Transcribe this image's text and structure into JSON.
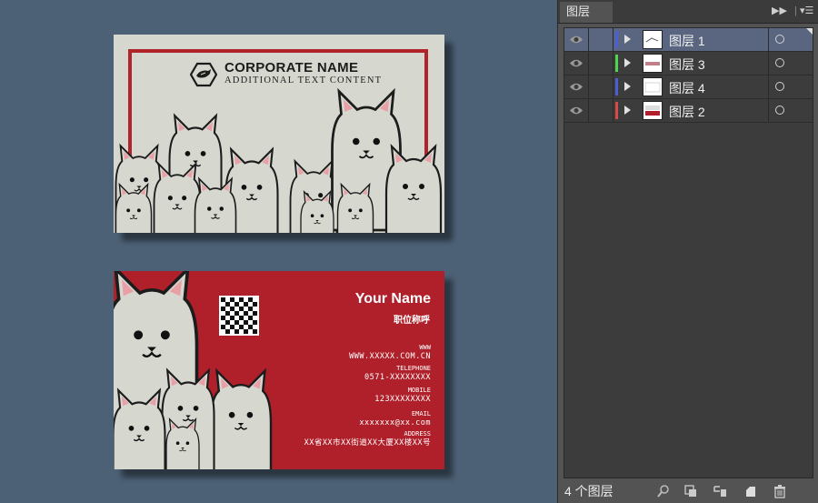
{
  "front_card": {
    "corp_name": "CORPORATE NAME",
    "corp_sub": "ADDITIONAL TEXT CONTENT"
  },
  "back_card": {
    "your_name": "Your Name",
    "job_title": "职位称呼",
    "contacts": [
      {
        "label": "WWW",
        "value": "WWW.XXXXX.COM.CN"
      },
      {
        "label": "TELEPHONE",
        "value": "0571-XXXXXXXX"
      },
      {
        "label": "MOBILE",
        "value": "123XXXXXXXX"
      },
      {
        "label": "EMAIL",
        "value": "xxxxxxx@xx.com"
      },
      {
        "label": "ADDRESS",
        "value": "XX省XX市XX街道XX大厦XX楼XX号"
      }
    ]
  },
  "layers_panel": {
    "title": "图层",
    "layers": [
      {
        "name": "图层 1",
        "color": "#4a5fd6",
        "selected": true
      },
      {
        "name": "图层 3",
        "color": "#4fd64f",
        "selected": false
      },
      {
        "name": "图层 4",
        "color": "#4a5fd6",
        "selected": false
      },
      {
        "name": "图层 2",
        "color": "#d64a4a",
        "selected": false
      }
    ],
    "count_text": "4 个图层"
  },
  "colors": {
    "card_red": "#b0202a",
    "card_gray": "#d6d8d0",
    "canvas_bg": "#4d6176"
  }
}
